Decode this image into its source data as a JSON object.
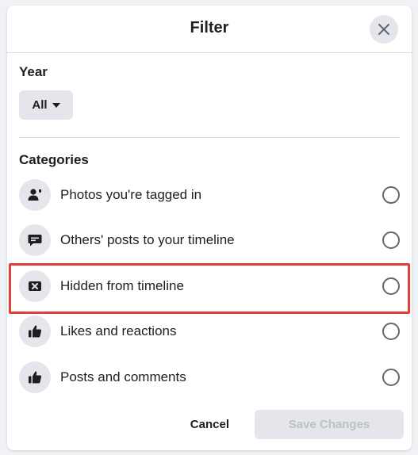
{
  "dialog": {
    "title": "Filter",
    "close_icon": "close-icon"
  },
  "year": {
    "label": "Year",
    "selected": "All"
  },
  "categories": {
    "label": "Categories",
    "items": [
      {
        "label": "Photos you're tagged in",
        "icon": "person-tag-icon",
        "selected": false
      },
      {
        "label": "Others' posts to your timeline",
        "icon": "comment-bubble-icon",
        "selected": false
      },
      {
        "label": "Hidden from timeline",
        "icon": "hidden-x-icon",
        "selected": false,
        "highlighted": true
      },
      {
        "label": "Likes and reactions",
        "icon": "thumbs-up-icon",
        "selected": false
      },
      {
        "label": "Posts and comments",
        "icon": "thumbs-up-icon",
        "selected": false
      }
    ]
  },
  "footer": {
    "cancel_label": "Cancel",
    "save_label": "Save Changes"
  },
  "colors": {
    "highlight": "#e0403a",
    "icon_bg": "#e4e6eb",
    "disabled_text": "#bcc0c4"
  }
}
